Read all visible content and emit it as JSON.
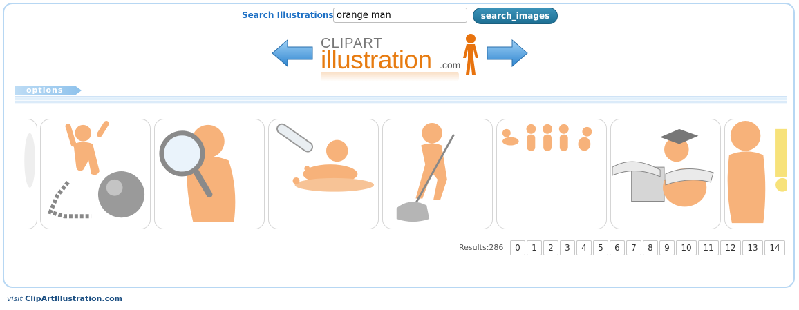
{
  "search": {
    "label": "Search Illustrations",
    "value": "orange man",
    "button_label": "search_images"
  },
  "logo": {
    "top_text": "CLIPART",
    "main_text": "illustration",
    "suffix": ".com"
  },
  "options": {
    "label": "options"
  },
  "thumbnails": [
    {
      "icon": "partial-illustration"
    },
    {
      "icon": "man-ball-and-chain"
    },
    {
      "icon": "man-magnifying-glass"
    },
    {
      "icon": "man-test-tube-spill"
    },
    {
      "icon": "man-mopping"
    },
    {
      "icon": "men-poses"
    },
    {
      "icon": "man-graduate-books"
    },
    {
      "icon": "man-exclamation"
    }
  ],
  "pagination": {
    "results_label": "Results:286",
    "pages": [
      "0",
      "1",
      "2",
      "3",
      "4",
      "5",
      "6",
      "7",
      "8",
      "9",
      "10",
      "11",
      "12",
      "13",
      "14"
    ]
  },
  "footer": {
    "visit_prefix": "visit",
    "visit_site": "ClipArtIllustration.com"
  },
  "colors": {
    "accent": "#1c6fc4",
    "figure_orange": "#f7b27a",
    "button": "#2a82a8",
    "border": "#b7d7f3"
  }
}
